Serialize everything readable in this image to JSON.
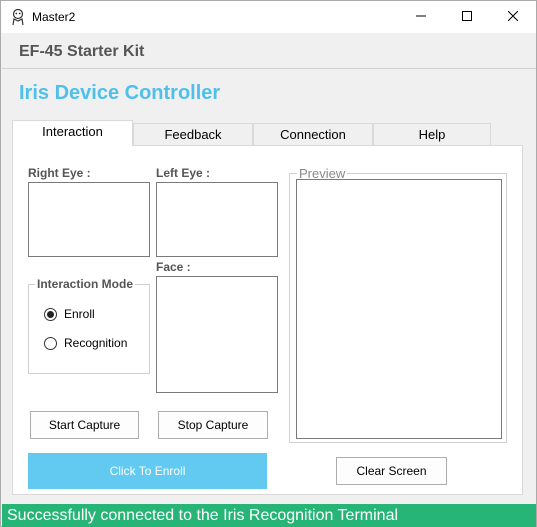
{
  "window": {
    "title": "Master2"
  },
  "header": {
    "kit_title": "EF-45 Starter Kit",
    "app_title": "Iris Device Controller"
  },
  "tabs": [
    {
      "label": "Interaction",
      "active": true
    },
    {
      "label": "Feedback",
      "active": false
    },
    {
      "label": "Connection",
      "active": false
    },
    {
      "label": "Help",
      "active": false
    }
  ],
  "interaction": {
    "right_eye_label": "Right Eye :",
    "left_eye_label": "Left Eye :",
    "face_label": "Face :",
    "mode_group_title": "Interaction Mode",
    "modes": [
      {
        "label": "Enroll",
        "checked": true
      },
      {
        "label": "Recognition",
        "checked": false
      }
    ],
    "preview_title": "Preview",
    "start_capture_label": "Start Capture",
    "stop_capture_label": "Stop Capture",
    "enroll_button_label": "Click To Enroll",
    "clear_screen_label": "Clear Screen"
  },
  "status": {
    "message": "Successfully connected to the Iris Recognition Terminal"
  },
  "colors": {
    "accent": "#4ec0ea",
    "enroll_button": "#62c9f0",
    "status_bar": "#26b477"
  }
}
